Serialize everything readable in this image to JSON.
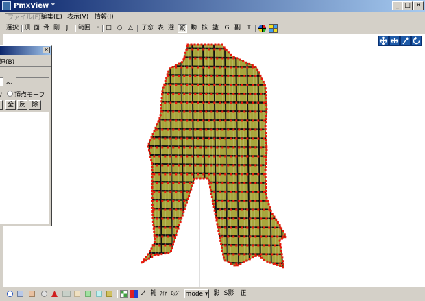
{
  "window": {
    "title": "PmxView *",
    "controls": [
      "_",
      "□",
      "×"
    ]
  },
  "menu": [
    "ファイル(F)",
    "編集(E)",
    "表示(V)",
    "情報(I)"
  ],
  "toolbar": {
    "mode_label": "選択",
    "items": [
      "頂",
      "面",
      "骨",
      "剛",
      "J",
      "範囲",
      "・",
      "□",
      "○",
      "△",
      "子窓",
      "表",
      "選",
      "絞",
      "動",
      "拡",
      "塗",
      "G",
      "副",
      "T"
    ]
  },
  "panel": {
    "menu_label": "速(B)",
    "tilde": "～",
    "radio_label": "頂点モーフ",
    "buttons": [
      "全",
      "反",
      "除"
    ]
  },
  "statusbar": {
    "labels": [
      "ノ",
      "軸",
      "ﾜｲﾔ",
      "ｴｯｼﾞ",
      "mode ▾",
      "影",
      "S影",
      "正"
    ]
  },
  "colors": {
    "title_start": "#0a246a",
    "title_end": "#a6caf0",
    "mesh_fill": "#a8a63c",
    "mesh_lines": "#111111",
    "vertex": "#e8180c",
    "nav_button": "#1e5aa8"
  },
  "icons": {
    "view": [
      "move-icon",
      "move-xy-icon",
      "rotate-icon",
      "reset-view-icon"
    ],
    "toolbar_extra": [
      "color-wheel-icon",
      "grid-color-icon"
    ]
  }
}
